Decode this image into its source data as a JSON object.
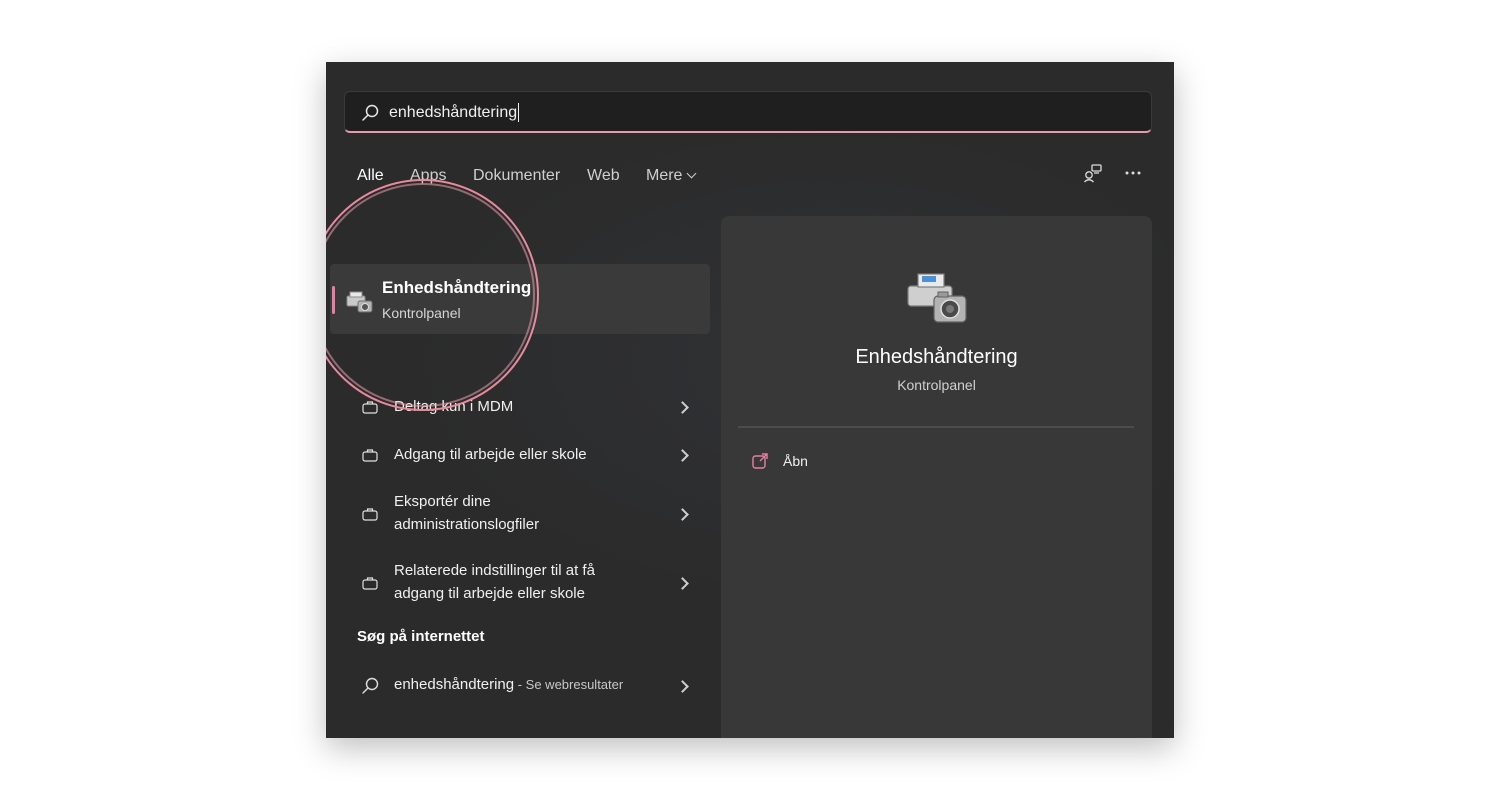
{
  "search": {
    "query": "enhedshåndtering"
  },
  "tabs": [
    {
      "label": "Alle"
    },
    {
      "label": "Apps"
    },
    {
      "label": "Dokumenter"
    },
    {
      "label": "Web"
    },
    {
      "label": "Mere"
    }
  ],
  "best_match": {
    "title": "Enhedshåndtering",
    "subtitle": "Kontrolpanel"
  },
  "settings_items": [
    {
      "label": "Deltag kun i MDM"
    },
    {
      "label": "Adgang til arbejde eller skole"
    },
    {
      "label": "Eksportér dine administrationslogfiler"
    },
    {
      "label": "Relaterede indstillinger til at få adgang til arbejde eller skole"
    }
  ],
  "web_section": {
    "heading": "Søg på internettet",
    "query": "enhedshåndtering",
    "suffix": " - Se webresultater"
  },
  "detail": {
    "title": "Enhedshåndtering",
    "subtitle": "Kontrolpanel",
    "action_open": "Åbn"
  },
  "colors": {
    "accent": "#e87fa0",
    "panel_bg": "#2b2b2b",
    "detail_bg": "#383838"
  }
}
